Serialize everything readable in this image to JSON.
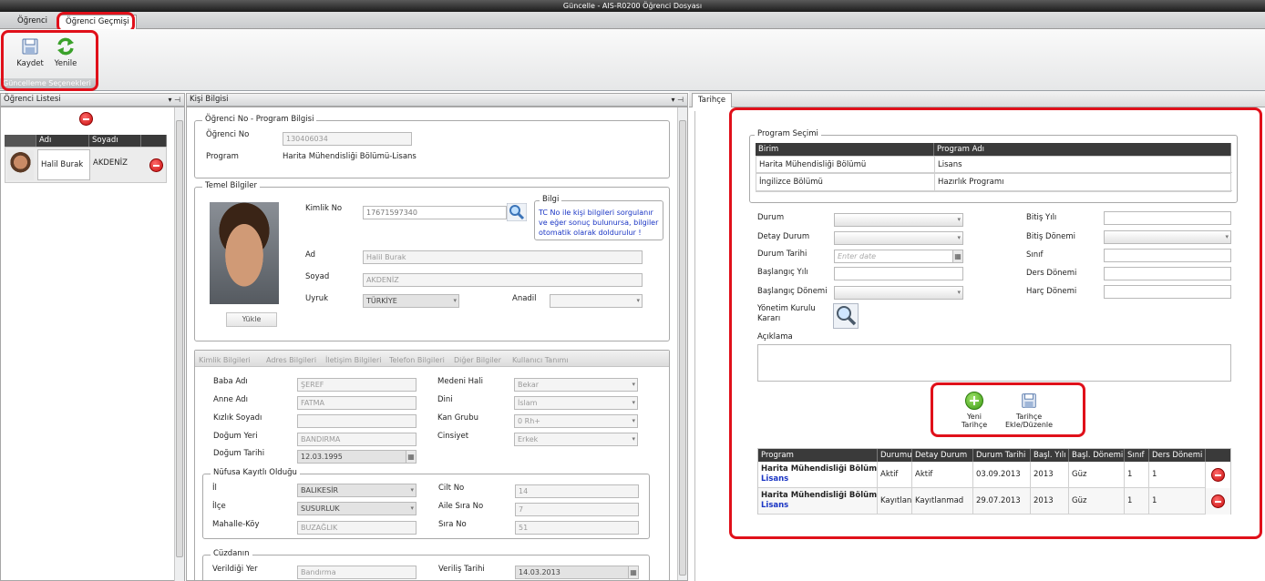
{
  "window": {
    "title": "Güncelle - AIS-R0200 Öğrenci Dosyası"
  },
  "ribbon": {
    "tabs": [
      {
        "label": "Öğrenci"
      },
      {
        "label": "Öğrenci Geçmişi"
      }
    ],
    "buttons": {
      "save": "Kaydet",
      "refresh": "Yenile"
    },
    "group_caption": "Güncelleme Seçenekleri"
  },
  "student_list": {
    "title": "Öğrenci Listesi",
    "columns": [
      "Adı",
      "Soyadı"
    ],
    "rows": [
      {
        "first_name": "Halil Burak",
        "last_name": "AKDENİZ"
      }
    ]
  },
  "person": {
    "title": "Kişi Bilgisi",
    "program_group": {
      "title": "Öğrenci No - Program Bilgisi",
      "student_no_label": "Öğrenci No",
      "student_no": "130406034",
      "program_label": "Program",
      "program": "Harita Mühendisliği Bölümü-Lisans"
    },
    "basic": {
      "title": "Temel Bilgiler",
      "id_label": "Kimlik No",
      "id_value": "17671597340",
      "info_title": "Bilgi",
      "info_text": "TC No ile kişi bilgileri sorgulanır ve eğer sonuç bulunursa, bilgiler otomatik olarak doldurulur !",
      "name_label": "Ad",
      "name_value": "Halil Burak",
      "surname_label": "Soyad",
      "surname_value": "AKDENİZ",
      "nationality_label": "Uyruk",
      "nationality_value": "TÜRKİYE",
      "mother_tongue_label": "Anadil",
      "mother_tongue_value": "",
      "upload_label": "Yükle"
    },
    "tabs": [
      "Kimlik Bilgileri",
      "Adres Bilgileri",
      "İletişim Bilgileri",
      "Telefon Bilgileri",
      "Diğer Bilgiler",
      "Kullanıcı Tanımı"
    ],
    "identity": {
      "father_label": "Baba Adı",
      "father_value": "ŞEREF",
      "mother_label": "Anne Adı",
      "mother_value": "FATMA",
      "maiden_label": "Kızlık Soyadı",
      "maiden_value": "",
      "birthplace_label": "Doğum Yeri",
      "birthplace_value": "BANDIRMA",
      "birthdate_label": "Doğum Tarihi",
      "birthdate_value": "12.03.1995",
      "marital_label": "Medeni Hali",
      "marital_value": "Bekar",
      "religion_label": "Dini",
      "religion_value": "İslam",
      "blood_label": "Kan Grubu",
      "blood_value": "0 Rh+",
      "gender_label": "Cinsiyet",
      "gender_value": "Erkek"
    },
    "registry": {
      "title": "Nüfusa Kayıtlı Olduğu",
      "province_label": "İl",
      "province_value": "BALIKESİR",
      "district_label": "İlçe",
      "district_value": "SUSURLUK",
      "village_label": "Mahalle-Köy",
      "village_value": "BUZAĞLIK",
      "volume_label": "Cilt No",
      "volume_value": "14",
      "family_label": "Aile Sıra No",
      "family_value": "7",
      "order_label": "Sıra No",
      "order_value": "51"
    },
    "wallet": {
      "title": "Cüzdanın",
      "place_label": "Verildiği Yer",
      "place_value": "Bandırma",
      "date_label": "Veriliş Tarihi",
      "date_value": "14.03.2013"
    }
  },
  "history": {
    "tab": "Tarihçe",
    "program_select": {
      "title": "Program Seçimi",
      "columns": [
        "Birim",
        "Program Adı"
      ],
      "rows": [
        [
          "Harita Mühendisliği Bölümü",
          "Lisans"
        ],
        [
          "İngilizce Bölümü",
          "Hazırlık Programı"
        ]
      ]
    },
    "form": {
      "status": "Durum",
      "detail_status": "Detay Durum",
      "status_date": "Durum Tarihi",
      "date_placeholder": "Enter date",
      "start_year": "Başlangıç Yılı",
      "start_term": "Başlangıç Dönemi",
      "board_decision": "Yönetim Kurulu Kararı",
      "end_year": "Bitiş Yılı",
      "end_term": "Bitiş Dönemi",
      "class": "Sınıf",
      "course_term": "Ders Dönemi",
      "fee_term": "Harç Dönemi",
      "description": "Açıklama"
    },
    "actions": {
      "new": "Yeni Tarihçe",
      "add_edit": "Tarihçe Ekle/Düzenle"
    },
    "table": {
      "columns": [
        "Program",
        "Durumu",
        "Detay Durum",
        "Durum Tarihi",
        "Başl. Yılı",
        "Başl. Dönemi",
        "Sınıf",
        "Ders Dönemi"
      ],
      "rows": [
        {
          "program": "Harita Mühendisliği Bölüm",
          "level": "Lisans",
          "status": "Aktif",
          "detail": "Aktif",
          "date": "03.09.2013",
          "start_year": "2013",
          "start_term": "Güz",
          "class": "1",
          "course_term": "1"
        },
        {
          "program": "Harita Mühendisliği Bölüm",
          "level": "Lisans",
          "status": "Kayıtlan",
          "detail": "Kayıtlanmad",
          "date": "29.07.2013",
          "start_year": "2013",
          "start_term": "Güz",
          "class": "1",
          "course_term": "1"
        }
      ]
    }
  },
  "colors": {
    "highlight": "#e0101a",
    "header": "#3a3a3a",
    "link": "#1a35c4"
  }
}
